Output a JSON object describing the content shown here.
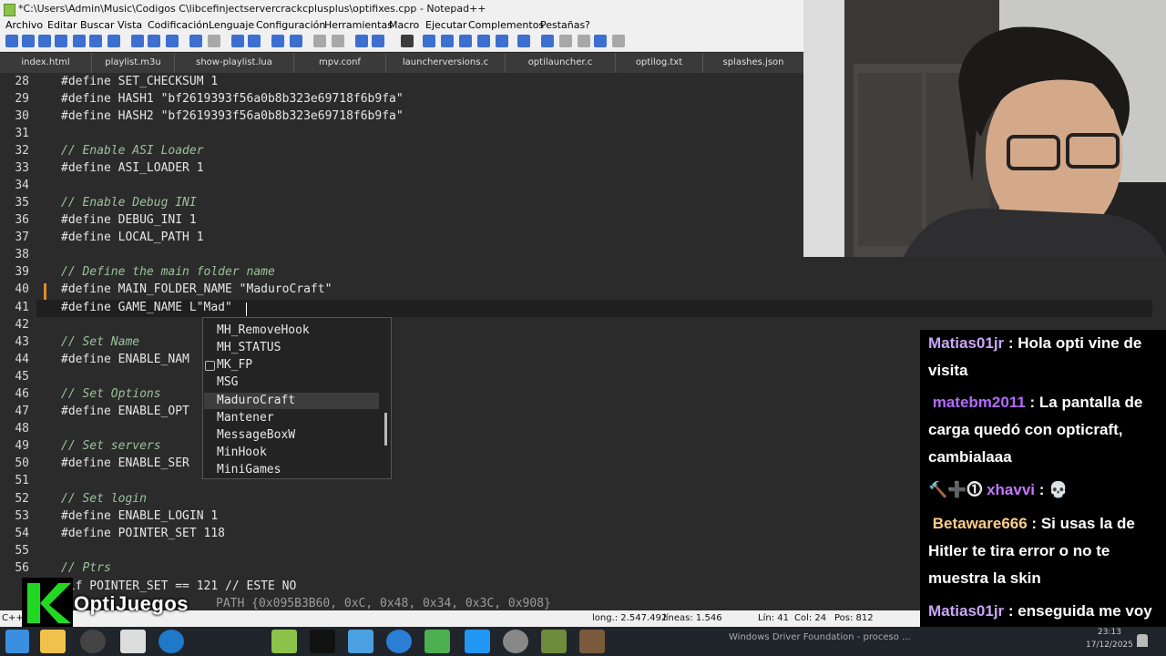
{
  "window": {
    "title": "*C:\\Users\\Admin\\Music\\Codigos C\\libcefinjectservercrackcplusplus\\optifixes.cpp - Notepad++"
  },
  "menu": [
    "Archivo",
    "Editar",
    "Buscar",
    "Vista",
    "Codificación",
    "Lenguaje",
    "Configuración",
    "Herramientas",
    "Macro",
    "Ejecutar",
    "Complementos",
    "Pestañas",
    "?"
  ],
  "tabs": [
    "index.html",
    "playlist.m3u",
    "show-playlist.lua",
    "mpv.conf",
    "launcherversions.c",
    "optilauncher.c",
    "optilog.txt",
    "splashes.json"
  ],
  "editor": {
    "lines": [
      {
        "n": "28",
        "text": "#define SET_CHECKSUM 1",
        "type": "code"
      },
      {
        "n": "29",
        "text": "#define HASH1 \"bf2619393f56a0b8b323e69718f6b9fa\"",
        "type": "code"
      },
      {
        "n": "30",
        "text": "#define HASH2 \"bf2619393f56a0b8b323e69718f6b9fa\"",
        "type": "code"
      },
      {
        "n": "31",
        "text": "",
        "type": "code"
      },
      {
        "n": "32",
        "text": "// Enable ASI Loader",
        "type": "comment"
      },
      {
        "n": "33",
        "text": "#define ASI_LOADER 1",
        "type": "code"
      },
      {
        "n": "34",
        "text": "",
        "type": "code"
      },
      {
        "n": "35",
        "text": "// Enable Debug INI",
        "type": "comment"
      },
      {
        "n": "36",
        "text": "#define DEBUG_INI 1",
        "type": "code"
      },
      {
        "n": "37",
        "text": "#define LOCAL_PATH 1",
        "type": "code"
      },
      {
        "n": "38",
        "text": "",
        "type": "code"
      },
      {
        "n": "39",
        "text": "// Define the main folder name",
        "type": "comment"
      },
      {
        "n": "40",
        "text": "#define MAIN_FOLDER_NAME \"MaduroCraft\"",
        "type": "code"
      },
      {
        "n": "41",
        "text": "#define GAME_NAME L\"Mad\"",
        "type": "code"
      },
      {
        "n": "42",
        "text": "",
        "type": "code"
      },
      {
        "n": "43",
        "text": "// Set Name",
        "type": "comment"
      },
      {
        "n": "44",
        "text": "#define ENABLE_NAM",
        "type": "code"
      },
      {
        "n": "45",
        "text": "",
        "type": "code"
      },
      {
        "n": "46",
        "text": "// Set Options",
        "type": "comment"
      },
      {
        "n": "47",
        "text": "#define ENABLE_OPT",
        "type": "code"
      },
      {
        "n": "48",
        "text": "",
        "type": "code"
      },
      {
        "n": "49",
        "text": "// Set servers",
        "type": "comment"
      },
      {
        "n": "50",
        "text": "#define ENABLE_SER",
        "type": "code"
      },
      {
        "n": "51",
        "text": "",
        "type": "code"
      },
      {
        "n": "52",
        "text": "// Set login",
        "type": "comment"
      },
      {
        "n": "53",
        "text": "#define ENABLE_LOGIN 1",
        "type": "code"
      },
      {
        "n": "54",
        "text": "#define POINTER_SET 118",
        "type": "code"
      },
      {
        "n": "55",
        "text": "",
        "type": "code"
      },
      {
        "n": "56",
        "text": "// Ptrs",
        "type": "comment"
      },
      {
        "n": "5",
        "text": "#if POINTER_SET == 121 // ESTE NO",
        "type": "code"
      },
      {
        "n": "5",
        "text": "PATH {0x095B3B60, 0xC, 0x48, 0x34, 0x3C, 0x908}",
        "type": "mute"
      }
    ]
  },
  "autocomplete": {
    "items": [
      "MH_RemoveHook",
      "MH_STATUS",
      "MK_FP",
      "MSG",
      "MaduroCraft",
      "Mantener",
      "MessageBoxW",
      "MinHook",
      "MiniGames"
    ],
    "selected": "MaduroCraft"
  },
  "status": {
    "lang": "C++",
    "length": "long.: 2.547.492",
    "lines": "líneas: 1.546",
    "ln": "Lín: 41",
    "col": "Col: 24",
    "pos": "Pos: 812"
  },
  "chat": [
    {
      "user": "Matias01jr",
      "user_color": "#c9a7f5",
      "message": "Hola opti vine de visita",
      "badges": ""
    },
    {
      "user": "matebm2011",
      "user_color": "#b36bff",
      "message": "La pantalla de carga quedó con opticraft, cambialaaa",
      "badges": ""
    },
    {
      "user": "xhavvi",
      "user_color": "#c477ff",
      "message": "💀",
      "badges": "🔨➕⓵"
    },
    {
      "user": "Betaware666",
      "user_color": "#ffce8a",
      "message": "Si usas la de Hitler te tira error o no te muestra la skin",
      "badges": ""
    },
    {
      "user": "Matias01jr",
      "user_color": "#c9a7f5",
      "message": "enseguida me voy a dormir",
      "badges": ""
    }
  ],
  "brand": {
    "name": "OptiJuegos"
  },
  "taskbar": {
    "notification": "Windows Driver Foundation - proceso ...",
    "time": "23:13",
    "date": "17/12/2025"
  },
  "colors": {
    "editor_bg": "#2b2b2b",
    "comment": "#9bc29b",
    "change_marker": "#e08a2c",
    "brand_green": "#23d823"
  }
}
